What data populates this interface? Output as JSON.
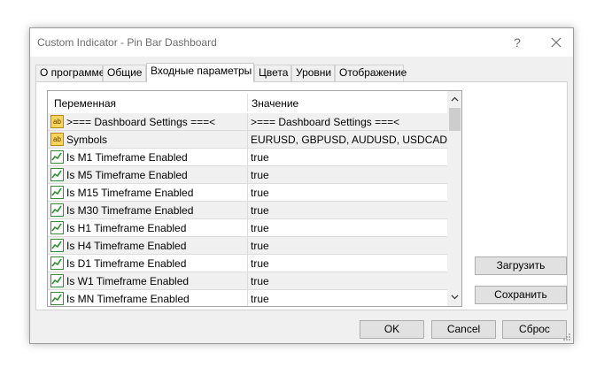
{
  "window": {
    "title": "Custom Indicator - Pin Bar Dashboard",
    "help_glyph": "?",
    "close_glyph": "✕"
  },
  "tabs": [
    {
      "label": "О программе",
      "active": false
    },
    {
      "label": "Общие",
      "active": false
    },
    {
      "label": "Входные параметры",
      "active": true
    },
    {
      "label": "Цвета",
      "active": false
    },
    {
      "label": "Уровни",
      "active": false
    },
    {
      "label": "Отображение",
      "active": false
    }
  ],
  "grid": {
    "headers": {
      "variable": "Переменная",
      "value": "Значение"
    },
    "rows": [
      {
        "icon": "string-type-icon",
        "icon_text": "ab",
        "name": ">=== Dashboard Settings ===<",
        "value": ">=== Dashboard Settings ===<"
      },
      {
        "icon": "string-type-icon",
        "icon_text": "ab",
        "name": "Symbols",
        "value": "EURUSD, GBPUSD, AUDUSD, USDCAD, ..."
      },
      {
        "icon": "bool-type-icon",
        "name": "Is M1 Timeframe Enabled",
        "value": "true"
      },
      {
        "icon": "bool-type-icon",
        "name": "Is M5 Timeframe Enabled",
        "value": "true"
      },
      {
        "icon": "bool-type-icon",
        "name": "Is M15 Timeframe Enabled",
        "value": "true"
      },
      {
        "icon": "bool-type-icon",
        "name": "Is M30 Timeframe Enabled",
        "value": "true"
      },
      {
        "icon": "bool-type-icon",
        "name": "Is H1 Timeframe Enabled",
        "value": "true"
      },
      {
        "icon": "bool-type-icon",
        "name": "Is H4 Timeframe Enabled",
        "value": "true"
      },
      {
        "icon": "bool-type-icon",
        "name": "Is D1 Timeframe Enabled",
        "value": "true"
      },
      {
        "icon": "bool-type-icon",
        "name": "Is W1 Timeframe Enabled",
        "value": "true"
      },
      {
        "icon": "bool-type-icon",
        "name": "Is MN Timeframe Enabled",
        "value": "true"
      }
    ],
    "scroll_up_glyph": "⌃",
    "scroll_down_glyph": "⌄"
  },
  "side_buttons": {
    "load": "Загрузить",
    "save": "Сохранить"
  },
  "footer": {
    "ok": "OK",
    "cancel": "Cancel",
    "reset": "Сброс"
  },
  "colors": {
    "accent": "#0078d7",
    "alt_row": "#f0f0f0",
    "dialog_bg": "#f0f0f0"
  }
}
